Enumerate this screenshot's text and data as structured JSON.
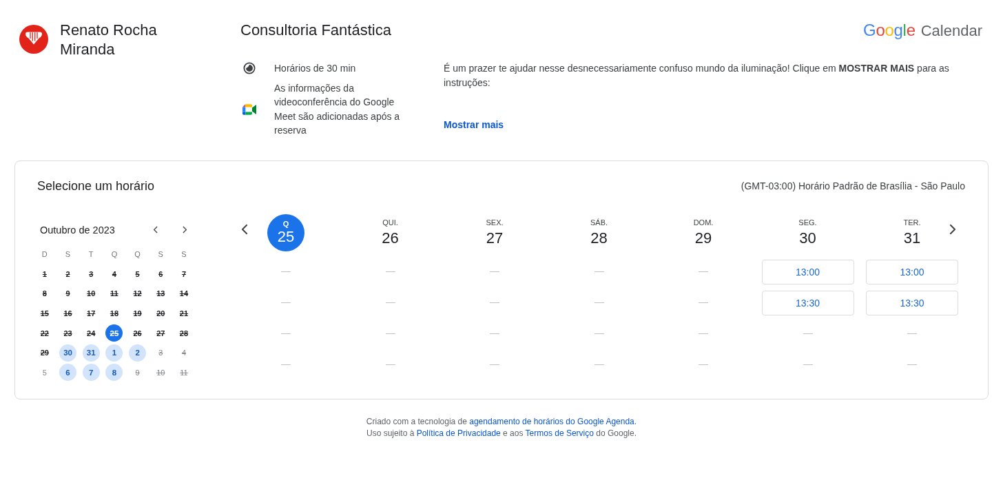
{
  "header": {
    "owner": {
      "name": "Renato Rocha Miranda"
    },
    "title": "Consultoria Fantástica",
    "logo": {
      "brand": "Google",
      "product": "Calendar"
    },
    "details": [
      {
        "kind": "duration",
        "text": "Horários de 30 min"
      },
      {
        "kind": "video",
        "text": "As informações da videoconferência do Google Meet são adicionadas após a reserva"
      }
    ],
    "description": "É um prazer te ajudar nesse desnecessariamente confuso mundo da iluminação! Clique em **MOSTRAR MAIS** para as instruções:",
    "more_link": "Mostrar mais"
  },
  "booking": {
    "title": "Selecione um horário",
    "timezone": "(GMT-03:00) Horário Padrão de Brasília - São Paulo",
    "calendar": {
      "month": "Outubro de 2023",
      "weekdays": [
        "D",
        "S",
        "T",
        "Q",
        "Q",
        "S",
        "S"
      ],
      "days": [
        {
          "label": "1",
          "available": false,
          "struck": true,
          "outside": false,
          "selected": false
        },
        {
          "label": "2",
          "available": false,
          "struck": true,
          "outside": false,
          "selected": false
        },
        {
          "label": "3",
          "available": false,
          "struck": true,
          "outside": false,
          "selected": false
        },
        {
          "label": "4",
          "available": false,
          "struck": true,
          "outside": false,
          "selected": false
        },
        {
          "label": "5",
          "available": false,
          "struck": true,
          "outside": false,
          "selected": false
        },
        {
          "label": "6",
          "available": false,
          "struck": true,
          "outside": false,
          "selected": false
        },
        {
          "label": "7",
          "available": false,
          "struck": true,
          "outside": false,
          "selected": false
        },
        {
          "label": "8",
          "available": false,
          "struck": true,
          "outside": false,
          "selected": false
        },
        {
          "label": "9",
          "available": false,
          "struck": true,
          "outside": false,
          "selected": false
        },
        {
          "label": "10",
          "available": false,
          "struck": true,
          "outside": false,
          "selected": false
        },
        {
          "label": "11",
          "available": false,
          "struck": true,
          "outside": false,
          "selected": false
        },
        {
          "label": "12",
          "available": false,
          "struck": true,
          "outside": false,
          "selected": false
        },
        {
          "label": "13",
          "available": false,
          "struck": true,
          "outside": false,
          "selected": false
        },
        {
          "label": "14",
          "available": false,
          "struck": true,
          "outside": false,
          "selected": false
        },
        {
          "label": "15",
          "available": false,
          "struck": true,
          "outside": false,
          "selected": false
        },
        {
          "label": "16",
          "available": false,
          "struck": true,
          "outside": false,
          "selected": false
        },
        {
          "label": "17",
          "available": false,
          "struck": true,
          "outside": false,
          "selected": false
        },
        {
          "label": "18",
          "available": false,
          "struck": true,
          "outside": false,
          "selected": false
        },
        {
          "label": "19",
          "available": false,
          "struck": true,
          "outside": false,
          "selected": false
        },
        {
          "label": "20",
          "available": false,
          "struck": true,
          "outside": false,
          "selected": false
        },
        {
          "label": "21",
          "available": false,
          "struck": true,
          "outside": false,
          "selected": false
        },
        {
          "label": "22",
          "available": false,
          "struck": true,
          "outside": false,
          "selected": false
        },
        {
          "label": "23",
          "available": false,
          "struck": true,
          "outside": false,
          "selected": false
        },
        {
          "label": "24",
          "available": false,
          "struck": true,
          "outside": false,
          "selected": false
        },
        {
          "label": "25",
          "available": false,
          "struck": true,
          "outside": false,
          "selected": true
        },
        {
          "label": "26",
          "available": false,
          "struck": true,
          "outside": false,
          "selected": false
        },
        {
          "label": "27",
          "available": false,
          "struck": true,
          "outside": false,
          "selected": false
        },
        {
          "label": "28",
          "available": false,
          "struck": true,
          "outside": false,
          "selected": false
        },
        {
          "label": "29",
          "available": false,
          "struck": true,
          "outside": false,
          "selected": false
        },
        {
          "label": "30",
          "available": true,
          "struck": false,
          "outside": false,
          "selected": false
        },
        {
          "label": "31",
          "available": true,
          "struck": false,
          "outside": false,
          "selected": false
        },
        {
          "label": "1",
          "available": true,
          "struck": false,
          "outside": true,
          "selected": false
        },
        {
          "label": "2",
          "available": true,
          "struck": false,
          "outside": true,
          "selected": false
        },
        {
          "label": "3",
          "available": false,
          "struck": true,
          "outside": true,
          "selected": false
        },
        {
          "label": "4",
          "available": false,
          "struck": true,
          "outside": true,
          "selected": false
        },
        {
          "label": "5",
          "available": false,
          "struck": false,
          "outside": true,
          "selected": false
        },
        {
          "label": "6",
          "available": true,
          "struck": false,
          "outside": true,
          "selected": false
        },
        {
          "label": "7",
          "available": true,
          "struck": false,
          "outside": true,
          "selected": false
        },
        {
          "label": "8",
          "available": true,
          "struck": false,
          "outside": true,
          "selected": false
        },
        {
          "label": "9",
          "available": false,
          "struck": true,
          "outside": true,
          "selected": false
        },
        {
          "label": "10",
          "available": false,
          "struck": true,
          "outside": true,
          "selected": false
        },
        {
          "label": "11",
          "available": false,
          "struck": true,
          "outside": true,
          "selected": false
        }
      ]
    },
    "week": {
      "days": [
        {
          "weekday": "Q",
          "date": "25",
          "selected": true,
          "slots": [
            {
              "kind": "none"
            },
            {
              "kind": "none"
            },
            {
              "kind": "none"
            },
            {
              "kind": "none"
            }
          ]
        },
        {
          "weekday": "QUI.",
          "date": "26",
          "selected": false,
          "slots": [
            {
              "kind": "none"
            },
            {
              "kind": "none"
            },
            {
              "kind": "none"
            },
            {
              "kind": "none"
            }
          ]
        },
        {
          "weekday": "SEX.",
          "date": "27",
          "selected": false,
          "slots": [
            {
              "kind": "none"
            },
            {
              "kind": "none"
            },
            {
              "kind": "none"
            },
            {
              "kind": "none"
            }
          ]
        },
        {
          "weekday": "SÁB.",
          "date": "28",
          "selected": false,
          "slots": [
            {
              "kind": "none"
            },
            {
              "kind": "none"
            },
            {
              "kind": "none"
            },
            {
              "kind": "none"
            }
          ]
        },
        {
          "weekday": "DOM.",
          "date": "29",
          "selected": false,
          "slots": [
            {
              "kind": "none"
            },
            {
              "kind": "none"
            },
            {
              "kind": "none"
            },
            {
              "kind": "none"
            }
          ]
        },
        {
          "weekday": "SEG.",
          "date": "30",
          "selected": false,
          "slots": [
            {
              "kind": "time",
              "label": "13:00"
            },
            {
              "kind": "time",
              "label": "13:30"
            },
            {
              "kind": "none"
            },
            {
              "kind": "none"
            }
          ]
        },
        {
          "weekday": "TER.",
          "date": "31",
          "selected": false,
          "slots": [
            {
              "kind": "time",
              "label": "13:00"
            },
            {
              "kind": "time",
              "label": "13:30"
            },
            {
              "kind": "none"
            },
            {
              "kind": "none"
            }
          ]
        }
      ]
    }
  },
  "footer": {
    "lines": [
      {
        "parts": [
          {
            "kind": "text",
            "text": "Criado com a tecnologia de "
          },
          {
            "kind": "link",
            "text": "agendamento de horários do Google Agenda"
          },
          {
            "kind": "text",
            "text": "."
          }
        ]
      },
      {
        "parts": [
          {
            "kind": "text",
            "text": "Uso sujeito à "
          },
          {
            "kind": "link",
            "text": "Política de Privacidade"
          },
          {
            "kind": "text",
            "text": " e aos "
          },
          {
            "kind": "link",
            "text": "Termos de Serviço"
          },
          {
            "kind": "text",
            "text": " do Google."
          }
        ]
      }
    ]
  }
}
